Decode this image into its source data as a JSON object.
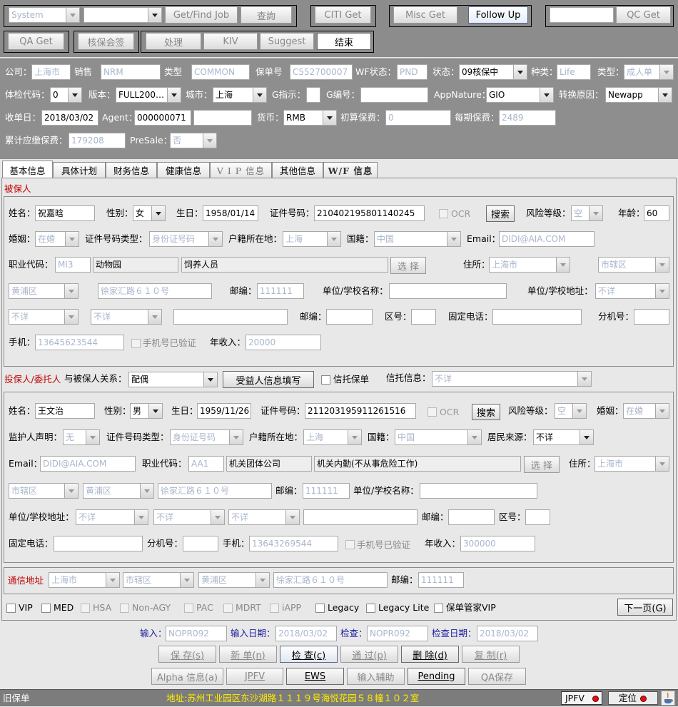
{
  "toolbar": {
    "row1": {
      "system_select": "System",
      "blank_select": "",
      "get_find_job": "Get/Find Job",
      "query": "查詢",
      "citi_get": "CITI Get",
      "misc_get": "Misc Get",
      "follow_up": "Follow Up",
      "qc_input": "",
      "qc_get": "QC Get"
    },
    "row2": {
      "qa_get": "QA Get",
      "review_sign": "核保会签",
      "process": "处理",
      "kiv": "KIV",
      "suggest": "Suggest",
      "finish": "结束"
    }
  },
  "header": {
    "company_label": "公司：",
    "company": "上海市",
    "sales_label": "销售",
    "sales": "NRM",
    "type_label": "类型",
    "type": "COMMON",
    "policy_no_label": "保单号",
    "policy_no": "C552700007",
    "wf_status_label": "WF状态：",
    "wf_status": "PND",
    "status_label": "状态：",
    "status": "09核保中",
    "kind_label": "种类：",
    "kind": "Life",
    "type2_label": "类型：",
    "type2": "成人单",
    "check_code_label": "体检代码：",
    "check_code": "0",
    "version_label": "版本：",
    "version": "FULL200…",
    "city_label": "城市：",
    "city": "上海",
    "g_indicator_label": "G指示：",
    "g_indicator": "",
    "g_no_label": "G编号：",
    "g_no": "",
    "app_nature_label": "AppNature：",
    "app_nature": "GIO",
    "convert_reason_label": "转换原因：",
    "convert_reason": "Newapp",
    "receive_date_label": "收单日：",
    "receive_date": "2018/03/02",
    "agent_label": "Agent：",
    "agent": "000000071",
    "agent2": "",
    "currency_label": "货币：",
    "currency": "RMB",
    "initial_premium_label": "初算保费：",
    "initial_premium": "0",
    "period_premium_label": "每期保费：",
    "period_premium": "2489",
    "cum_premium_label": "累计应缴保费：",
    "cum_premium": "179208",
    "presale_label": "PreSale：",
    "presale": "否"
  },
  "tabs": [
    "基本信息",
    "具体计划",
    "财务信息",
    "健康信息",
    "V I P 信息",
    "其他信息",
    "W/F 信息"
  ],
  "insured": {
    "section": "被保人",
    "name_label": "姓名：",
    "name": "祝嘉晗",
    "gender_label": "性别：",
    "gender": "女",
    "birth_label": "生日：",
    "birth": "1958/01/14",
    "id_label": "证件号码：",
    "id": "210402195801140245",
    "ocr": "OCR",
    "search": "搜索",
    "risk_label": "风险等级：",
    "risk": "空",
    "age_label": "年龄：",
    "age": "60",
    "marriage_label": "婚姻：",
    "marriage": "在婚",
    "id_type_label": "证件号码类型：",
    "id_type": "身份证号码",
    "hukou_label": "户籍所在地：",
    "hukou": "上海",
    "nation_label": "国籍：",
    "nation": "中国",
    "email_label": "Email：",
    "email": "DIDI@AIA.COM",
    "occ_code_label": "职业代码：",
    "occ_code": "MI3",
    "occ_name": "动物园",
    "occ_desc": "饲养人员",
    "choose": "选 择",
    "residence_label": "住所：",
    "res_city": "上海市",
    "res_district": "市辖区",
    "res_area": "黄浦区",
    "res_address": "徐家汇路６１０号",
    "zip_label": "邮编：",
    "zip": "111111",
    "employer_label": "单位/学校名称：",
    "employer": "",
    "employer_addr_label": "单位/学校地址：",
    "employer_addr": "不详",
    "emp_a": "不详",
    "emp_b": "不详",
    "emp_c": "",
    "emp_zip_label": "邮编：",
    "emp_zip": "",
    "area_code_label": "区号：",
    "area_code": "",
    "phone_label": "固定电话：",
    "phone": "",
    "ext_label": "分机号：",
    "ext": "",
    "mobile_label": "手机：",
    "mobile": "13645623544",
    "mobile_verified": "手机号已验证",
    "income_label": "年收入：",
    "income": "20000"
  },
  "holder_bar": {
    "section": "投保人/委托人",
    "relation_label": "与被保人关系：",
    "relation": "配偶",
    "beneficiary_btn": "受益人信息填写",
    "trust_policy": "信托保单",
    "trust_info_label": "信托信息：",
    "trust_info": "不详"
  },
  "holder": {
    "name_label": "姓名：",
    "name": "王文治",
    "gender_label": "性别：",
    "gender": "男",
    "birth_label": "生日：",
    "birth": "1959/11/26",
    "id_label": "证件号码：",
    "id": "211203195911261516",
    "ocr": "OCR",
    "search": "搜索",
    "risk_label": "风险等级：",
    "risk": "空",
    "marriage_label": "婚姻：",
    "marriage": "在婚",
    "guardian_label": "监护人声明：",
    "guardian": "无",
    "id_type_label": "证件号码类型：",
    "id_type": "身份证号码",
    "hukou_label": "户籍所在地：",
    "hukou": "上海",
    "nation_label": "国籍：",
    "nation": "中国",
    "source_label": "居民来源：",
    "source": "不详",
    "email_label": "Email：",
    "email": "DIDI@AIA.COM",
    "occ_code_label": "职业代码：",
    "occ_code": "AA1",
    "occ_name": "机关团体公司",
    "occ_desc": "机关内勤(不从事危险工作)",
    "choose": "选 择",
    "residence_label": "住所：",
    "res_city": "上海市",
    "res_district": "市辖区",
    "res_area": "黄浦区",
    "res_address": "徐家汇路６１０号",
    "zip_label": "邮编：",
    "zip": "111111",
    "employer_label": "单位/学校名称：",
    "employer": "",
    "employer_addr_label": "单位/学校地址：",
    "emp_a": "不详",
    "emp_b": "不详",
    "emp_c": "不详",
    "emp_d": "",
    "emp_zip_label": "邮编：",
    "emp_zip": "",
    "area_code_label": "区号：",
    "area_code": "",
    "phone_label": "固定电话：",
    "phone": "",
    "ext_label": "分机号：",
    "ext": "",
    "mobile_label": "手机：",
    "mobile": "13643269544",
    "mobile_verified": "手机号已验证",
    "income_label": "年收入：",
    "income": "300000"
  },
  "mail": {
    "label": "通信地址",
    "city": "上海市",
    "district": "市辖区",
    "area": "黄浦区",
    "address": "徐家汇路６１０号",
    "zip_label": "邮编：",
    "zip": "111111"
  },
  "flags": {
    "items": [
      "VIP",
      "MED",
      "HSA",
      "Non-AGY",
      "PAC",
      "MDRT",
      "iAPP",
      "Legacy",
      "Legacy Lite",
      "保单管家VIP"
    ],
    "next_page": "下一页(G)"
  },
  "audit": {
    "input_label": "输入：",
    "input": "NOPR092",
    "input_date_label": "输入日期：",
    "input_date": "2018/03/02",
    "check_label": "检查：",
    "check": "NOPR092",
    "check_date_label": "检查日期：",
    "check_date": "2018/03/02"
  },
  "actions": {
    "save": "保 存(s)",
    "new": "新 单(n)",
    "check": "检 查(c)",
    "pass": "通 过(p)",
    "delete": "删 除(d)",
    "copy": "复 制(r)",
    "alpha": "Alpha 信息(a)",
    "jpfv": "JPFV",
    "ews": "EWS",
    "input_help": "输入辅助",
    "pending": "Pending",
    "qa_save": "QA保存"
  },
  "status": {
    "old_policy": "旧保单",
    "address": "地址:苏州工业园区东沙湖路１１１９号海悦花园５８幢１０２室",
    "jpfv": "JPFV",
    "locate": "定位"
  },
  "colors": {
    "toolbar": "#8c8c8c",
    "section_red": "#c00000",
    "label_blue": "#1a1aa0",
    "address_yellow": "#ffee00",
    "status_bar": "#7c7c7c"
  }
}
